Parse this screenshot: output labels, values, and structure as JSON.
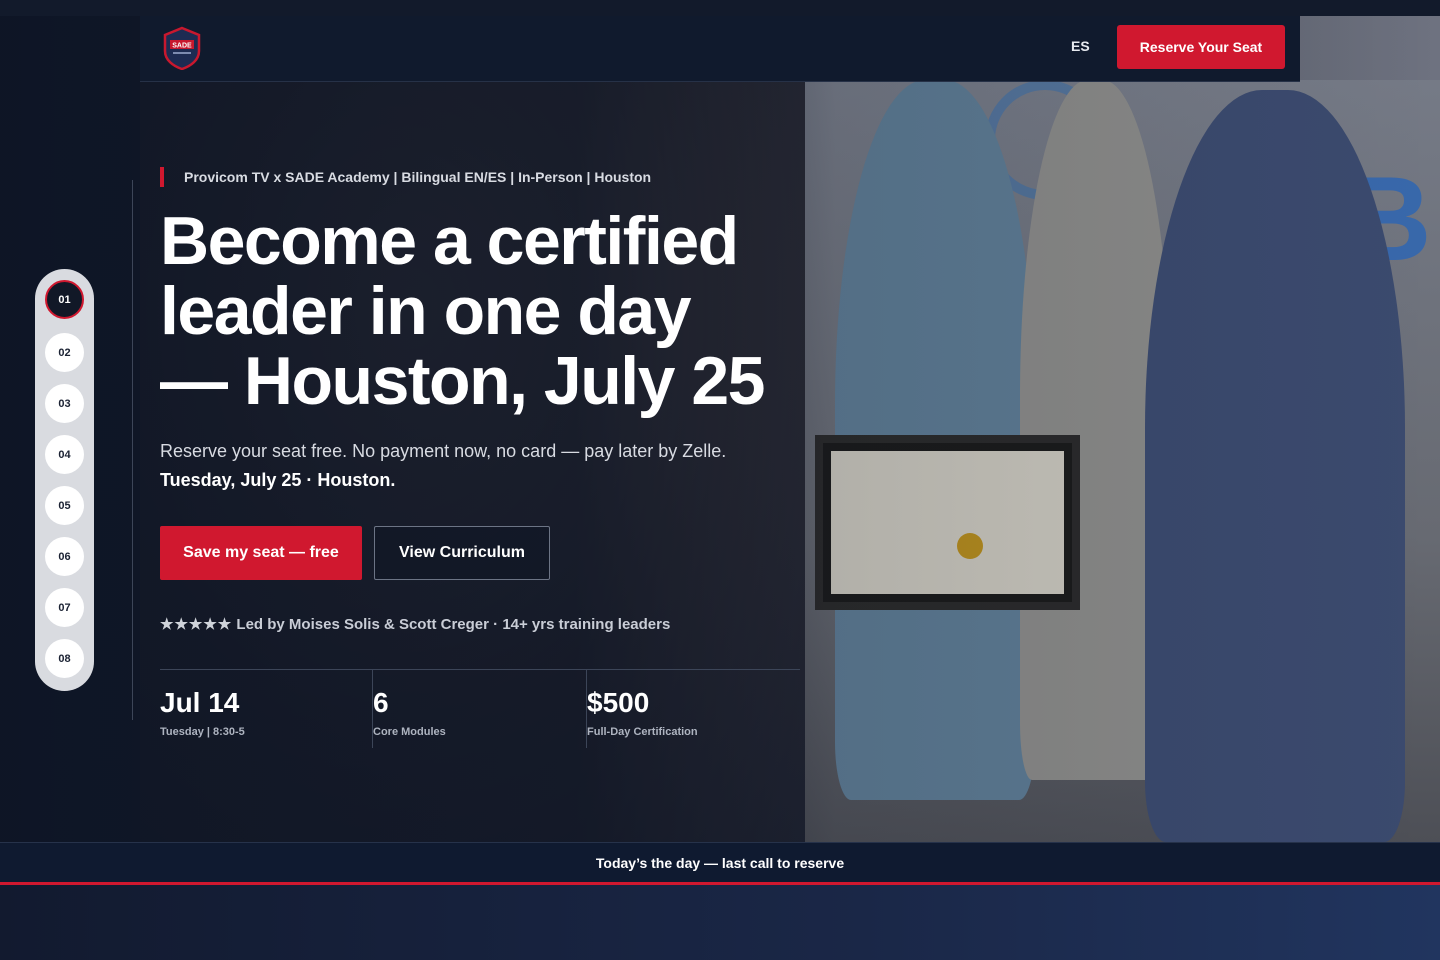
{
  "brand": {
    "logo_text": "SADE",
    "accent": "#d0182f",
    "navy": "#101a2d"
  },
  "nav": {
    "lang_toggle": "ES",
    "cta": "Reserve Your Seat"
  },
  "stepper": {
    "steps": [
      "01",
      "02",
      "03",
      "04",
      "05",
      "06",
      "07",
      "08"
    ],
    "active_index": 0
  },
  "hero": {
    "eyebrow": "Provicom TV x SADE Academy | Bilingual EN/ES | In-Person | Houston",
    "headline_line1": "Become a certified",
    "headline_line2": "leader in one day",
    "headline_line3": "— Houston, July 25",
    "subtext": "Reserve your seat free. No payment now, no card — pay later by Zelle.",
    "subtext_strong": "Tuesday, July 25 · Houston.",
    "primary_button": "Save my seat — free",
    "secondary_button": "View Curriculum",
    "stars": "★★★★★",
    "trust_text": "Led by Moises Solis & Scott Creger · 14+ yrs training leaders"
  },
  "stats": [
    {
      "value": "Jul 14",
      "label": "Tuesday | 8:30-5"
    },
    {
      "value": "6",
      "label": "Core Modules"
    },
    {
      "value": "$500",
      "label": "Full-Day Certification"
    }
  ],
  "banner": {
    "text": "Today’s the day — last call to reserve"
  },
  "icons": {
    "logo": "shield-logo-icon",
    "stars": "star-rating-icon"
  }
}
